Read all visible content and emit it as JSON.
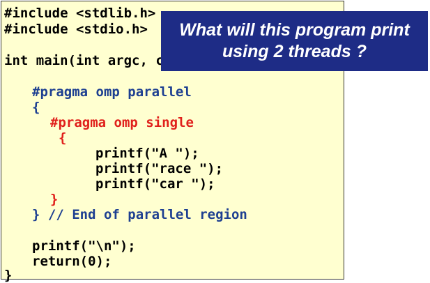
{
  "code": {
    "include_stdlib": "#include <stdlib.h>",
    "include_stdio": "#include <stdio.h>",
    "main_signature": "int main(int argc, char *argv[])",
    "pragma_parallel": "#pragma omp parallel",
    "open_parallel_brace": "{",
    "pragma_single": "#pragma omp single",
    "open_single_brace": "{",
    "printf_a": "printf(\"A \");",
    "printf_race": "printf(\"race \");",
    "printf_car": "printf(\"car \");",
    "close_single_brace": "}",
    "close_parallel": "} // End of parallel region",
    "printf_newline": "printf(\"\\n\");",
    "return_stmt": "return(0);",
    "close_main_brace": "}"
  },
  "callout": {
    "line1": "What will this program print",
    "line2": "using 2 threads ?"
  },
  "colors": {
    "panel_background": "#ffffd0",
    "pragma_parallel": "#1d3f91",
    "pragma_single": "#e0201b",
    "callout_background": "#1e2c86",
    "callout_text": "#ffffff"
  }
}
